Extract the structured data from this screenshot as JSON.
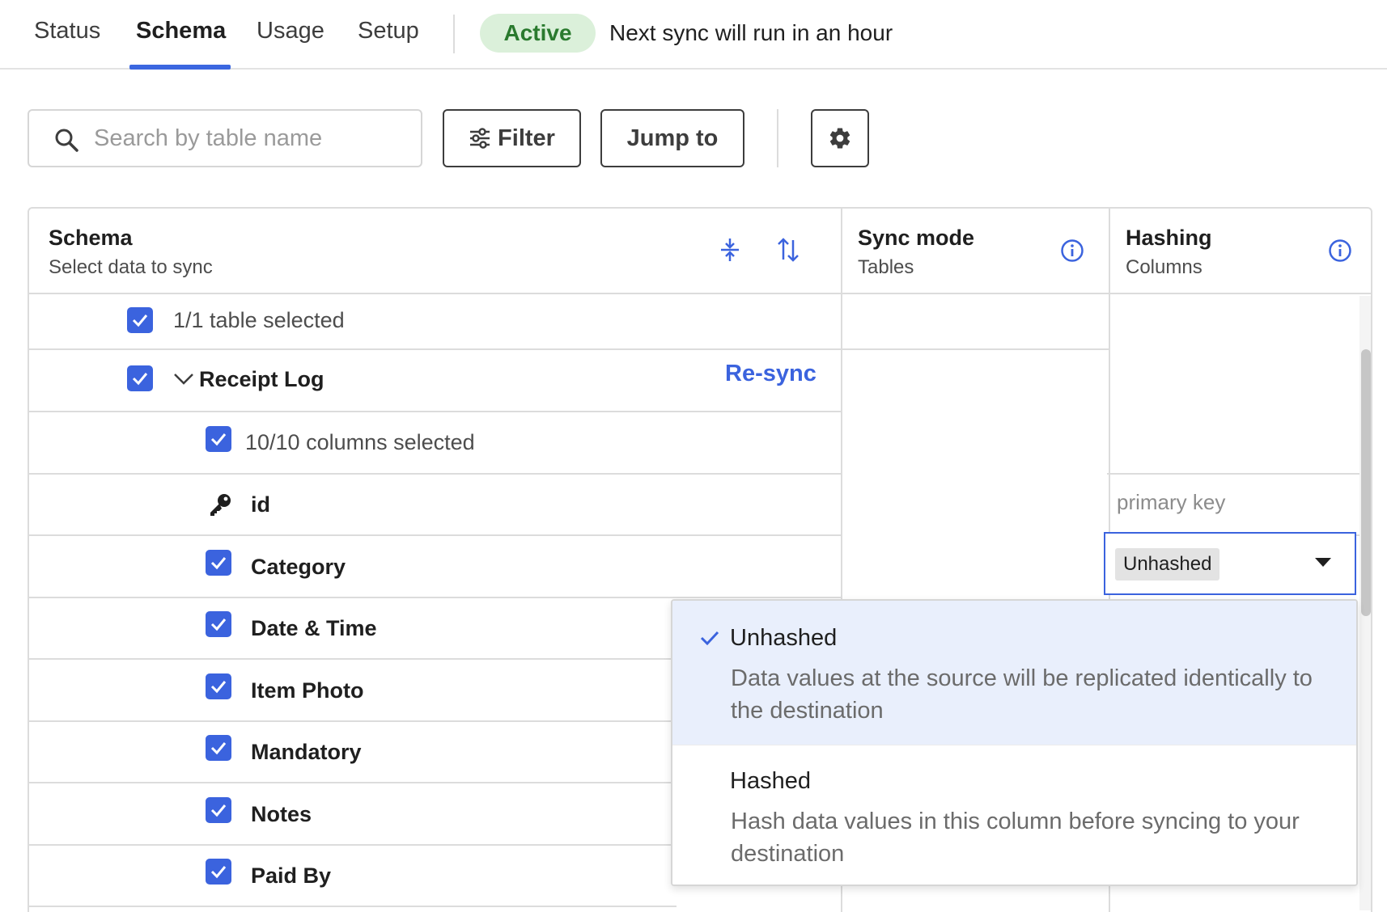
{
  "tabs": [
    {
      "label": "Status"
    },
    {
      "label": "Schema",
      "active": true
    },
    {
      "label": "Usage"
    },
    {
      "label": "Setup"
    }
  ],
  "status": {
    "badge": "Active",
    "note": "Next sync will run in an hour"
  },
  "toolbar": {
    "search_placeholder": "Search by table name",
    "filter_label": "Filter",
    "jump_label": "Jump to"
  },
  "table": {
    "columns": {
      "schema": {
        "title": "Schema",
        "subtitle": "Select data to sync"
      },
      "sync_mode": {
        "title": "Sync mode",
        "subtitle": "Tables"
      },
      "hashing": {
        "title": "Hashing",
        "subtitle": "Columns"
      }
    },
    "tables_selected": "1/1 table selected",
    "table_name": "Receipt Log",
    "resync_label": "Re-sync",
    "columns_selected": "10/10 columns selected",
    "primary_key_column": "id",
    "primary_key_label": "primary key",
    "rows": [
      "Category",
      "Date & Time",
      "Item Photo",
      "Mandatory",
      "Notes",
      "Paid By"
    ],
    "hash_selected": "Unhashed"
  },
  "dropdown": {
    "options": [
      {
        "label": "Unhashed",
        "description": "Data values at the source will be replicated identically to the destination",
        "selected": true
      },
      {
        "label": "Hashed",
        "description": "Hash data values in this column before syncing to your destination",
        "selected": false
      }
    ]
  },
  "colors": {
    "accent": "#3b63de",
    "active_badge_bg": "#dbf0da",
    "active_badge_text": "#2a7a2e",
    "selected_option_bg": "#e9effc"
  }
}
